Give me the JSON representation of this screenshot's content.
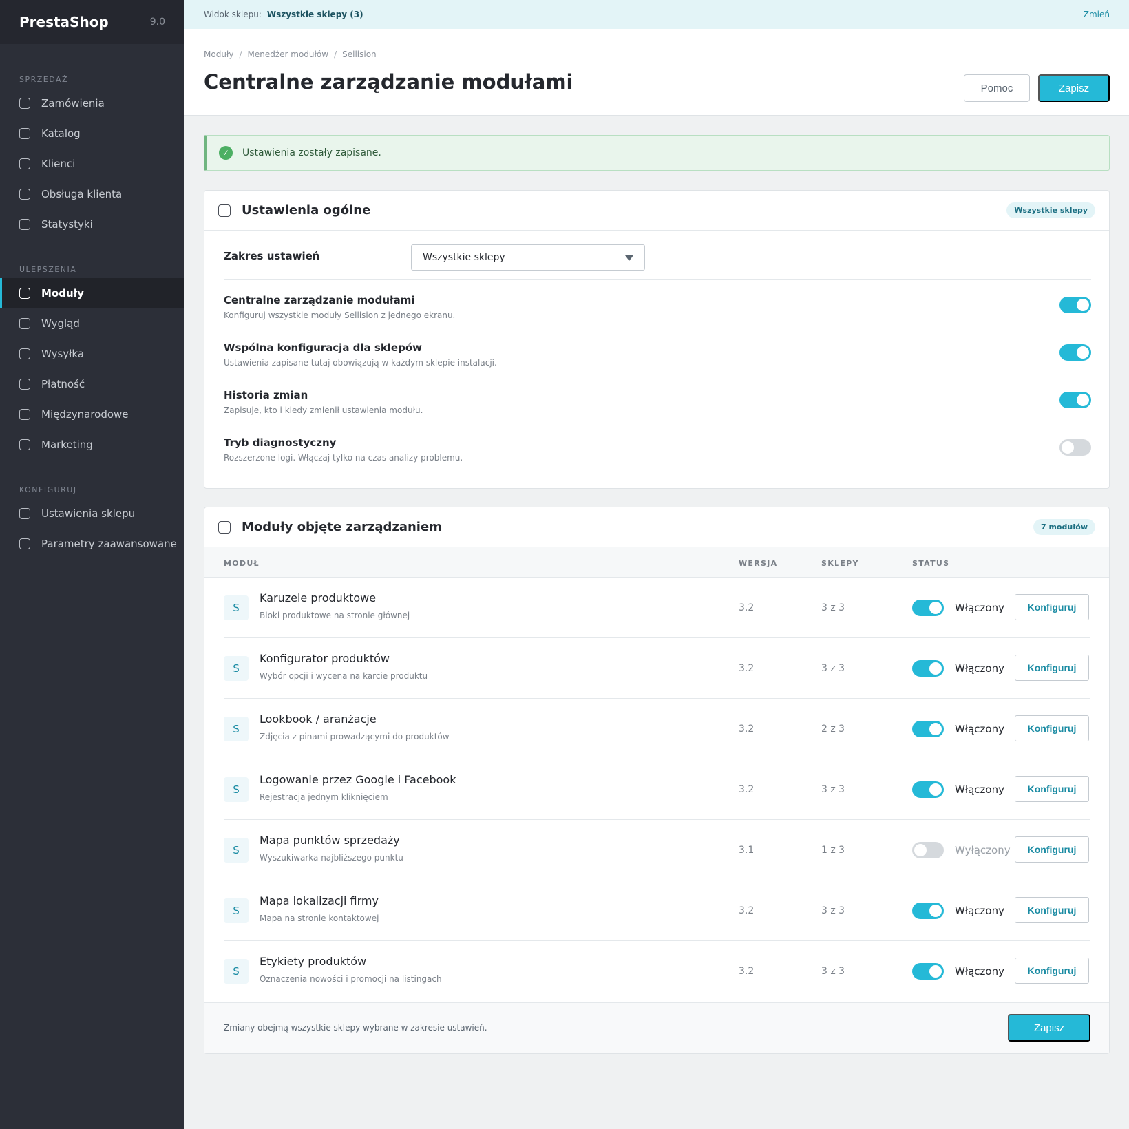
{
  "brand": {
    "name": "PrestaShop",
    "version": "9.0"
  },
  "sidebar": {
    "sections": [
      {
        "title": "SPRZEDAŻ",
        "items": [
          "Zamówienia",
          "Katalog",
          "Klienci",
          "Obsługa klienta",
          "Statystyki"
        ]
      },
      {
        "title": "ULEPSZENIA",
        "items": [
          "Moduły",
          "Wygląd",
          "Wysyłka",
          "Płatność",
          "Międzynarodowe",
          "Marketing"
        ]
      },
      {
        "title": "KONFIGURUJ",
        "items": [
          "Ustawienia sklepu",
          "Parametry zaawansowane"
        ]
      }
    ],
    "active": "Moduły"
  },
  "shopbar": {
    "label": "Widok sklepu:",
    "value": "Wszystkie sklepy (3)",
    "change": "Zmień"
  },
  "header": {
    "breadcrumbs": [
      "Moduły",
      "Menedżer modułów",
      "Sellision"
    ],
    "title": "Centralne zarządzanie modułami",
    "help_label": "Pomoc",
    "save_label": "Zapisz"
  },
  "alert": {
    "text": "Ustawienia zostały zapisane."
  },
  "general": {
    "title": "Ustawienia ogólne",
    "badge": "Wszystkie sklepy",
    "scope_label": "Zakres ustawień",
    "scope_value": "Wszystkie sklepy",
    "settings": [
      {
        "name": "Centralne zarządzanie modułami",
        "desc": "Konfiguruj wszystkie moduły Sellision z jednego ekranu.",
        "on": true
      },
      {
        "name": "Wspólna konfiguracja dla sklepów",
        "desc": "Ustawienia zapisane tutaj obowiązują w każdym sklepie instalacji.",
        "on": true
      },
      {
        "name": "Historia zmian",
        "desc": "Zapisuje, kto i kiedy zmienił ustawienia modułu.",
        "on": true
      },
      {
        "name": "Tryb diagnostyczny",
        "desc": "Rozszerzone logi. Włączaj tylko na czas analizy problemu.",
        "on": false
      }
    ]
  },
  "modules": {
    "title": "Moduły objęte zarządzaniem",
    "badge": "7 modułów",
    "columns": {
      "module": "MODUŁ",
      "version": "WERSJA",
      "shops": "SKLEPY",
      "status": "STATUS"
    },
    "rows": [
      {
        "letter": "S",
        "name": "Karuzele produktowe",
        "desc": "Bloki produktowe na stronie głównej",
        "version": "3.2",
        "shops": "3 z 3",
        "on": true,
        "status": "Włączony",
        "action": "Konfiguruj"
      },
      {
        "letter": "S",
        "name": "Konfigurator produktów",
        "desc": "Wybór opcji i wycena na karcie produktu",
        "version": "3.2",
        "shops": "3 z 3",
        "on": true,
        "status": "Włączony",
        "action": "Konfiguruj"
      },
      {
        "letter": "S",
        "name": "Lookbook / aranżacje",
        "desc": "Zdjęcia z pinami prowadzącymi do produktów",
        "version": "3.2",
        "shops": "2 z 3",
        "on": true,
        "status": "Włączony",
        "action": "Konfiguruj"
      },
      {
        "letter": "S",
        "name": "Logowanie przez Google i Facebook",
        "desc": "Rejestracja jednym kliknięciem",
        "version": "3.2",
        "shops": "3 z 3",
        "on": true,
        "status": "Włączony",
        "action": "Konfiguruj"
      },
      {
        "letter": "S",
        "name": "Mapa punktów sprzedaży",
        "desc": "Wyszukiwarka najbliższego punktu",
        "version": "3.1",
        "shops": "1 z 3",
        "on": false,
        "status": "Wyłączony",
        "action": "Konfiguruj"
      },
      {
        "letter": "S",
        "name": "Mapa lokalizacji firmy",
        "desc": "Mapa na stronie kontaktowej",
        "version": "3.2",
        "shops": "3 z 3",
        "on": true,
        "status": "Włączony",
        "action": "Konfiguruj"
      },
      {
        "letter": "S",
        "name": "Etykiety produktów",
        "desc": "Oznaczenia nowości i promocji na listingach",
        "version": "3.2",
        "shops": "3 z 3",
        "on": true,
        "status": "Włączony",
        "action": "Konfiguruj"
      }
    ],
    "footer_note": "Zmiany obejmą wszystkie sklepy wybrane w zakresie ustawień.",
    "save_label": "Zapisz"
  },
  "colors": {
    "accent": "#25b9d7",
    "sidebar": "#2c2f38",
    "success": "#4caf63"
  }
}
